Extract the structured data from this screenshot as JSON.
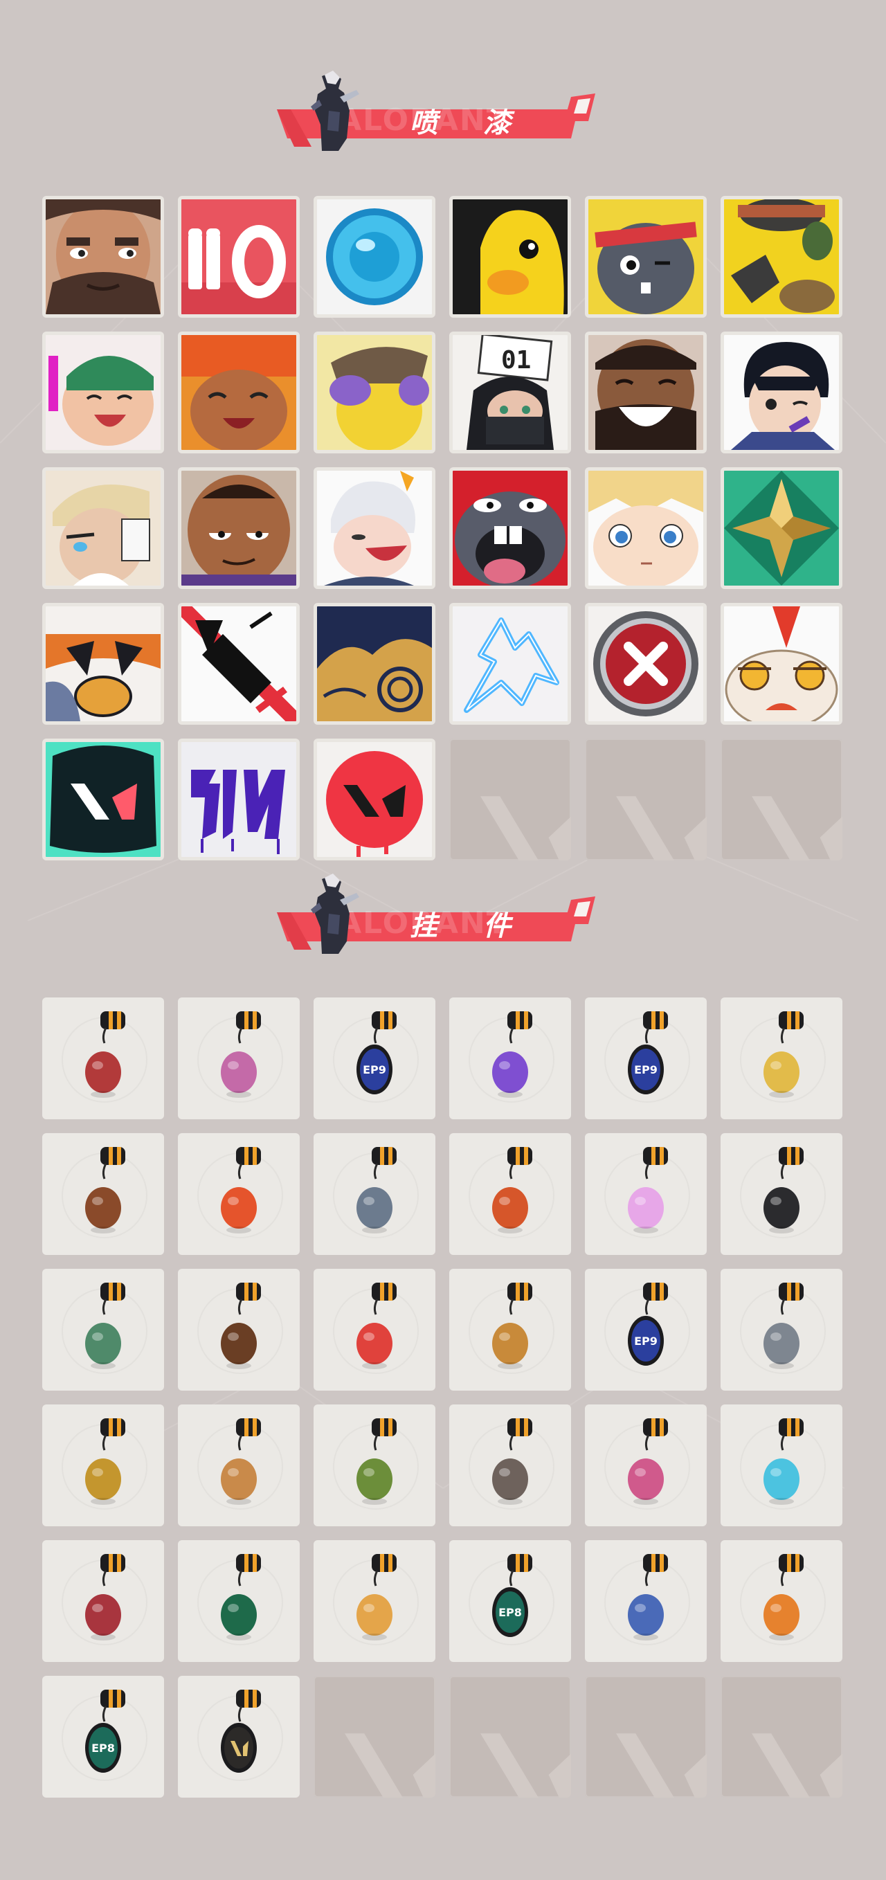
{
  "sections": {
    "sprays": {
      "title": "喷 漆",
      "watermark": "VALORANT",
      "items": [
        {
          "icon": "bearded-agent-spray-icon"
        },
        {
          "icon": "ammo-counter-spray-icon"
        },
        {
          "icon": "blue-orb-spray-icon"
        },
        {
          "icon": "yellow-creature-spray-icon"
        },
        {
          "icon": "headband-critter-spray-icon"
        },
        {
          "icon": "grenade-hands-spray-icon"
        },
        {
          "icon": "laughing-green-cap-agent-spray-icon"
        },
        {
          "icon": "fire-hair-agent-spray-icon"
        },
        {
          "icon": "purple-yellow-creature-spray-icon"
        },
        {
          "icon": "masked-agent-01-sign-spray-icon"
        },
        {
          "icon": "laughing-bearded-agent-spray-icon"
        },
        {
          "icon": "winking-agent-spray-icon"
        },
        {
          "icon": "blonde-agent-portrait-spray-icon"
        },
        {
          "icon": "smug-agent-spray-icon"
        },
        {
          "icon": "white-hair-agent-spray-icon"
        },
        {
          "icon": "screaming-critter-spray-icon"
        },
        {
          "icon": "blonde-kid-agent-spray-icon"
        },
        {
          "icon": "gold-star-emblem-spray-icon"
        },
        {
          "icon": "duck-bill-spray-icon"
        },
        {
          "icon": "no-spray-can-spray-icon"
        },
        {
          "icon": "golden-clouds-spray-icon"
        },
        {
          "icon": "neon-lightning-spray-icon"
        },
        {
          "icon": "red-x-button-spray-icon"
        },
        {
          "icon": "dragon-dance-spray-icon"
        },
        {
          "icon": "valorant-logo-splash-spray-icon"
        },
        {
          "icon": "purple-graffiti-spray-icon"
        },
        {
          "icon": "red-valorant-logo-spray-icon"
        }
      ],
      "empty_slots": 3
    },
    "buddies": {
      "title": "挂 件",
      "watermark": "VALORANT",
      "items": [
        {
          "icon": "braided-cord-buddy-icon"
        },
        {
          "icon": "cupcake-buddy-icon"
        },
        {
          "icon": "ep9-medallion-buddy-icon",
          "label": "EP9"
        },
        {
          "icon": "lava-lamp-buddy-icon"
        },
        {
          "icon": "ep9-medallion-buddy-icon",
          "label": "EP9"
        },
        {
          "icon": "banana-bread-buddy-icon"
        },
        {
          "icon": "ice-cream-bar-buddy-icon"
        },
        {
          "icon": "fruit-skewer-buddy-icon"
        },
        {
          "icon": "agent-figure-buddy-icon"
        },
        {
          "icon": "hot-air-balloon-buddy-icon"
        },
        {
          "icon": "pink-chibi-buddy-icon"
        },
        {
          "icon": "microphone-buddy-icon"
        },
        {
          "icon": "robot-buddy-icon"
        },
        {
          "icon": "lute-buddy-icon"
        },
        {
          "icon": "watermelon-buddy-icon"
        },
        {
          "icon": "beehive-buddy-icon"
        },
        {
          "icon": "ep9-medallion-buddy-icon",
          "label": "EP9"
        },
        {
          "icon": "dragon-wisp-buddy-icon"
        },
        {
          "icon": "gold-mech-buddy-icon"
        },
        {
          "icon": "fox-creature-buddy-icon"
        },
        {
          "icon": "green-goblin-buddy-icon"
        },
        {
          "icon": "raccoon-buddy-icon"
        },
        {
          "icon": "pink-mech-buddy-icon"
        },
        {
          "icon": "blue-crystal-buddy-icon"
        },
        {
          "icon": "octopus-buddy-icon"
        },
        {
          "icon": "green-gem-buddy-icon"
        },
        {
          "icon": "sun-creature-buddy-icon"
        },
        {
          "icon": "ep8-medallion-buddy-icon",
          "label": "EP8"
        },
        {
          "icon": "ufo-buddy-icon"
        },
        {
          "icon": "tiger-buddy-icon"
        },
        {
          "icon": "ep8-medallion-buddy-icon",
          "label": "EP8"
        },
        {
          "icon": "gold-valorant-medallion-buddy-icon"
        }
      ],
      "empty_slots": 4
    }
  },
  "colors": {
    "background": "#cdc6c4",
    "banner_red": "#ef4a56",
    "tile_bg": "#ebe9e5",
    "empty_tile": "#c4bbb7"
  }
}
